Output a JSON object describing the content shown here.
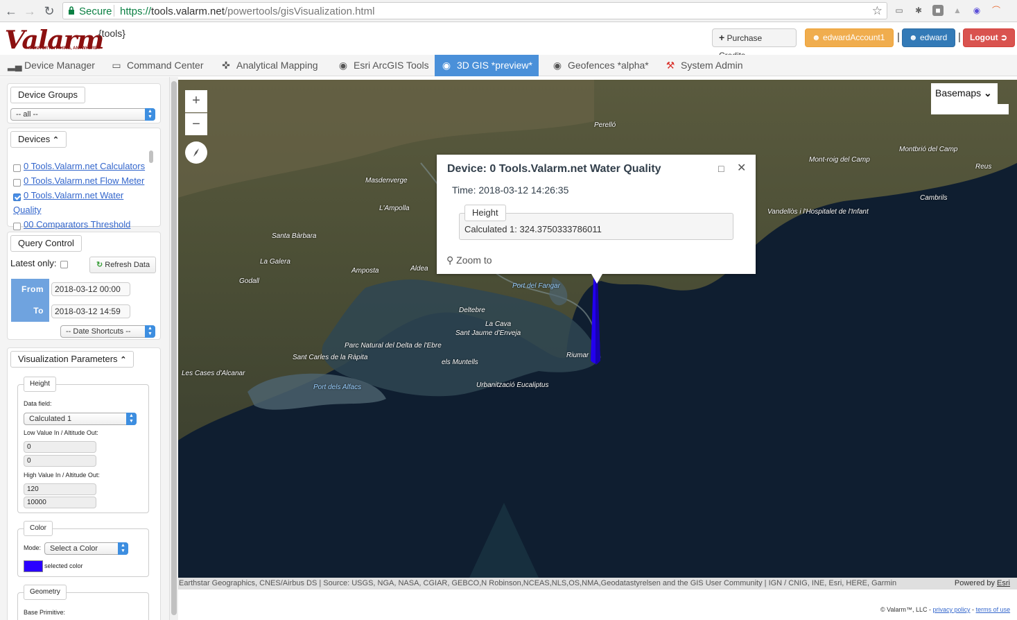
{
  "browser": {
    "secure_label": "Secure",
    "url_scheme": "https://",
    "url_host": "tools.valarm.net",
    "url_path": "/powertools/gisVisualization.html"
  },
  "header": {
    "logo_text": "Valarm",
    "logo_tagline": "MONITOR ANYTHING, ANYWHERE®",
    "tools_tag": "{tools}",
    "purchase_credits": "Purchase Credits",
    "account": "edwardAccount1",
    "user": "edward",
    "logout": "Logout",
    "separator": "|"
  },
  "nav": {
    "items": [
      {
        "label": "Device Manager",
        "icon": "signal-icon"
      },
      {
        "label": "Command Center",
        "icon": "monitor-icon"
      },
      {
        "label": "Analytical Mapping",
        "icon": "crosshair-icon"
      },
      {
        "label": "Esri ArcGIS Tools",
        "icon": "globe-icon"
      },
      {
        "label": "3D GIS *preview*",
        "icon": "globe-icon",
        "active": true
      },
      {
        "label": "Geofences *alpha*",
        "icon": "globe-icon"
      },
      {
        "label": "System Admin",
        "icon": "wrench-icon"
      }
    ]
  },
  "sidebar": {
    "device_groups": {
      "tab": "Device Groups",
      "selected": "-- all --"
    },
    "devices": {
      "tab": "Devices",
      "items": [
        {
          "label": "0 Tools.Valarm.net Calculators",
          "checked": false
        },
        {
          "label": "0 Tools.Valarm.net Flow Meter",
          "checked": false
        },
        {
          "label_line1": "0 Tools.Valarm.net Water",
          "label_line2": "Quality",
          "checked": true
        },
        {
          "label": "00 Comparators Threshold",
          "checked": false
        }
      ]
    },
    "query": {
      "tab": "Query Control",
      "latest_only": "Latest only:",
      "refresh": "Refresh Data",
      "from_label": "From",
      "from_value": "2018-03-12 00:00",
      "to_label": "To",
      "to_value": "2018-03-12 14:59",
      "date_shortcuts": "-- Date Shortcuts --"
    },
    "viz": {
      "tab": "Visualization Parameters",
      "height": {
        "label": "Height",
        "data_field_label": "Data field:",
        "data_field_value": "Calculated 1",
        "low_label": "Low Value In / Altitude Out:",
        "low_in": "0",
        "low_out": "0",
        "high_label": "High Value In / Altitude Out:",
        "high_in": "120",
        "high_out": "10000"
      },
      "color": {
        "label": "Color",
        "mode_label": "Mode:",
        "mode_value": "Select a Color",
        "swatch_label": "selected color",
        "selected_color": "#2a00ff"
      },
      "geometry": {
        "label": "Geometry",
        "base_primitive_label": "Base Primitive:"
      }
    }
  },
  "map": {
    "zoom_in": "+",
    "zoom_out": "−",
    "basemaps": "Basemaps",
    "place_labels": [
      "Port del Fangar",
      "Deltebre",
      "La Cava",
      "Sant Jaume d'Enveja",
      "Parc Natural del Delta de l'Ebre",
      "Sant Carles de la Ràpita",
      "els Muntells",
      "Urbanització Eucaliptus",
      "Port dels Alfacs",
      "Riumar",
      "Aldea",
      "Amposta",
      "Les Cases d'Alcanar",
      "Godall",
      "La Galera",
      "Masdenverge",
      "Santa Bàrbara",
      "L'Ampolla",
      "Perelló",
      "Cambrils",
      "Reus",
      "Vandellòs i l'Hospitalet de l'Infant",
      "Montbrió del Camp",
      "Mont-roig del Camp"
    ],
    "popup": {
      "title": "Device: 0 Tools.Valarm.net Water Quality",
      "time": "Time: 2018-03-12 14:26:35",
      "section_label": "Height",
      "value_line": "Calculated 1: 324.3750333786011",
      "zoom_to": "Zoom to"
    },
    "attribution": "Earthstar Geographics, CNES/Airbus DS | Source: USGS, NGA, NASA, CGIAR, GEBCO,N Robinson,NCEAS,NLS,OS,NMA,Geodatastyrelsen and the GIS User Community | IGN / CNIG, INE, Esri, HERE, Garmin",
    "powered_by": "Powered by",
    "powered_link": "Esri"
  },
  "footer": {
    "copyright": "© Valarm™, LLC -",
    "privacy": "privacy policy",
    "dash": "-",
    "terms": "terms of use"
  }
}
